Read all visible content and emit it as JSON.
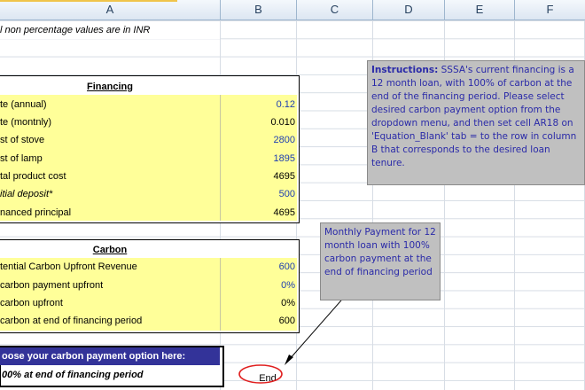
{
  "columns": [
    "A",
    "B",
    "C",
    "D",
    "E",
    "F"
  ],
  "note_top": "l non percentage values are in INR",
  "financing": {
    "title": "Financing",
    "rows": [
      {
        "label": "te (annual)",
        "value": "0.12",
        "blue": true,
        "italic": false
      },
      {
        "label": "te (montnly)",
        "value": "0.010",
        "blue": false,
        "italic": false
      },
      {
        "label": "st of stove",
        "value": "2800",
        "blue": true,
        "italic": false
      },
      {
        "label": "st of lamp",
        "value": "1895",
        "blue": true,
        "italic": false
      },
      {
        "label": "tal product cost",
        "value": "4695",
        "blue": false,
        "italic": false
      },
      {
        "label": "itial deposit*",
        "value": "500",
        "blue": true,
        "italic": true
      },
      {
        "label": "nanced principal",
        "value": "4695",
        "blue": false,
        "italic": false
      }
    ]
  },
  "carbon": {
    "title": "Carbon",
    "rows": [
      {
        "label": "tential Carbon Upfront Revenue",
        "value": "600",
        "blue": true
      },
      {
        "label": "carbon payment upfront",
        "value": "0%",
        "blue": true
      },
      {
        "label": "carbon upfront",
        "value": "0%",
        "blue": false
      },
      {
        "label": "carbon at end of financing period",
        "value": "600",
        "blue": false
      }
    ]
  },
  "choose": {
    "header": "oose your carbon payment option here:",
    "selected": "00% at end of financing period"
  },
  "end_cell": "End",
  "instructions": "Instructions: SSSA's current financing is a 12 month loan, with 100% of carbon at the end of the financing period. Please select desired carbon payment option from the dropdown menu, and then set cell AR18 on 'Equation_Blank' tab = to the row in column B that corresponds to the desired loan tenure.",
  "instructions_bold": "Instructions:",
  "instructions_rest": " SSSA's current financing is a 12 month loan, with 100% of carbon at the end of the financing period. Please select desired carbon payment option from the dropdown menu, and then set cell AR18 on 'Equation_Blank' tab = to the row in column B that corresponds to the desired loan tenure.",
  "monthly_note": "Monthly Payment for 12 month loan with 100% carbon payment at the end of financing period",
  "colors": {
    "header_bg": "#dce6f2",
    "yellow": "#ffff99",
    "dark_header": "#333399",
    "note_bg": "#c0c0c0",
    "note_text": "#2a2aa8",
    "oval": "#e02020"
  }
}
